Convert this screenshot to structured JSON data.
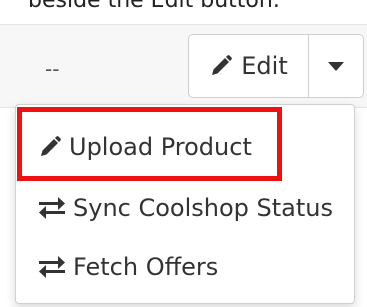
{
  "caption": "beside the Edit button.",
  "row": {
    "placeholder": "--"
  },
  "actions": {
    "edit_label": "Edit",
    "edit_icon": "pencil-icon",
    "caret_icon": "caret-down-icon"
  },
  "menu": {
    "items": [
      {
        "label": "Upload Product",
        "icon": "pencil-icon"
      },
      {
        "label": "Sync Coolshop Status",
        "icon": "exchange-icon"
      },
      {
        "label": "Fetch Offers",
        "icon": "exchange-icon"
      }
    ]
  },
  "colors": {
    "highlight": "#ee1111",
    "text": "#333333"
  }
}
